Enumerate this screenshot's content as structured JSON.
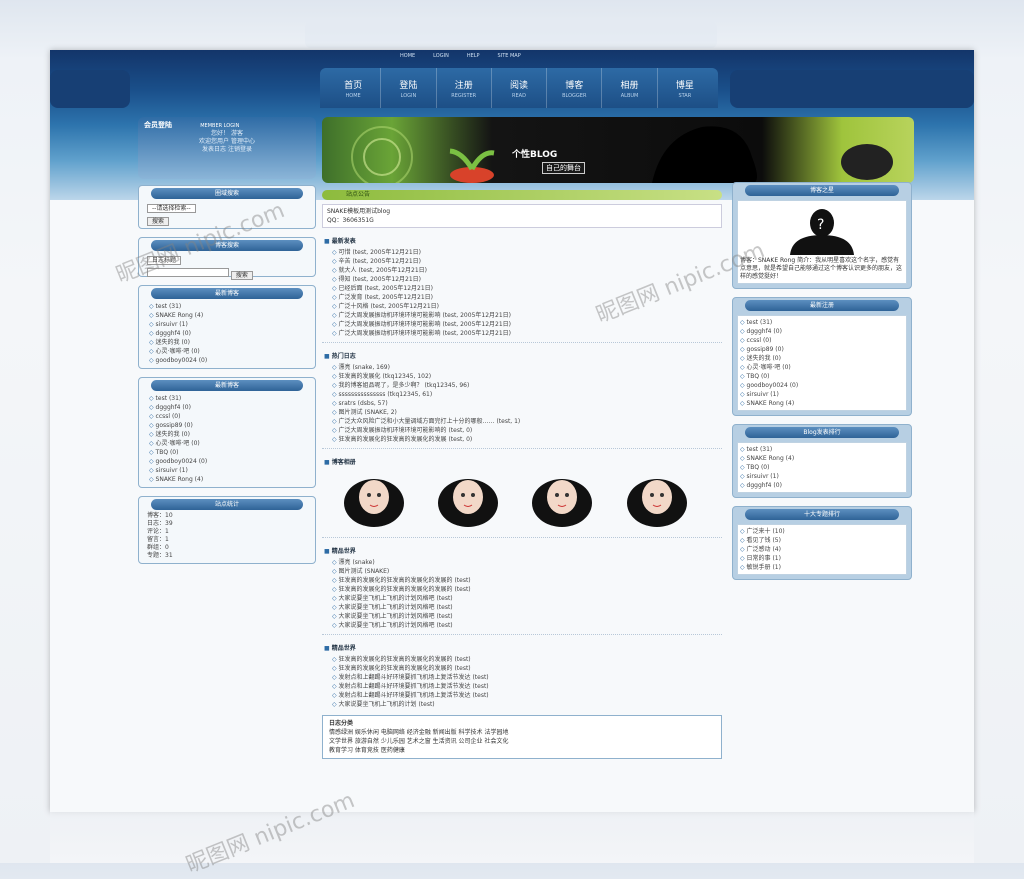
{
  "toplinks": [
    "HOME",
    "LOGIN",
    "HELP",
    "SITE MAP"
  ],
  "nav": [
    {
      "cn": "首页",
      "en": "HOME"
    },
    {
      "cn": "登陆",
      "en": "LOGIN"
    },
    {
      "cn": "注册",
      "en": "REGISTER"
    },
    {
      "cn": "阅读",
      "en": "READ"
    },
    {
      "cn": "博客",
      "en": "BLOGGER"
    },
    {
      "cn": "相册",
      "en": "ALBUM"
    },
    {
      "cn": "博星",
      "en": "STAR"
    }
  ],
  "left": {
    "login_title": "会员登陆",
    "login_en": "MEMBER LOGIN",
    "login_lines": [
      "您好！",
      "游客",
      "欢迎您用户",
      "管理中心",
      "发表日志",
      "注销登录"
    ],
    "section_titles": [
      "圈域搜索",
      "博客搜索",
      "最新博客",
      "最新博客",
      "站点统计"
    ],
    "search_select": "--请选择检索--",
    "search_button": "搜索",
    "blog_select": "日志标题",
    "blog_button": "搜索",
    "newest": [
      "test (31)",
      "SNAKE Rong (4)",
      "sirsuivr (1)",
      "dggghf4 (0)",
      "迷失的我 (0)",
      "心灵·咖啡·吧 (0)",
      "goodboy0024 (0)"
    ],
    "latest": [
      "test (31)",
      "dggghf4 (0)",
      "ccssl (0)",
      "gossip89 (0)",
      "迷失的我 (0)",
      "心灵·咖啡·吧 (0)",
      "TBQ (0)",
      "goodboy0024 (0)",
      "sirsuivr (1)",
      "SNAKE Rong (4)"
    ],
    "stats": [
      "博客：10",
      "日志：39",
      "评论：1",
      "留言：1",
      "群组：0",
      "专题：31"
    ]
  },
  "banner": {
    "title": "个性BLOG",
    "subtitle": "自己的舞台"
  },
  "main": {
    "notice_title": "站点公告",
    "notice_lines": [
      "SNAKE模板用测试blog",
      "QQ：3606351G"
    ],
    "sec_new": "最新发表",
    "new_posts": [
      "可惜 (test, 2005年12月21日)",
      "辛苦 (test, 2005年12月21日)",
      "就大人 (test, 2005年12月21日)",
      "得知 (test, 2005年12月21日)",
      "已经后面 (test, 2005年12月21日)",
      "广泛发育 (test, 2005年12月21日)",
      "广泛十风格 (test, 2005年12月21日)",
      "广泛大周发展振动机环境环境可能影响 (test, 2005年12月21日)",
      "广泛大周发展振动机环境环境可能影响 (test, 2005年12月21日)",
      "广泛大周发展振动机环境环境可能影响 (test, 2005年12月21日)"
    ],
    "sec_hot": "热门日志",
    "hot_posts": [
      "漂亮 (snake, 169)",
      "狂发高的发展化 (tkq12345, 102)",
      "我的博客姐品呢了，是多少啊？ (tkq12345, 96)",
      "sssssssssssssss (tkq12345, 61)",
      "sratrs (dsbs, 57)",
      "图片测试 (SNAKE, 2)",
      "广泛大众风险广泛和小大量调域方面完打上十分的哪般…… (test, 1)",
      "广泛大周发展振动机环境环境可能影响的 (test, 0)",
      "狂发高的发展化的狂发高的发展化的发展 (test, 0)"
    ],
    "sec_star": "博客相册",
    "sec_w1": "精品世界",
    "w1_posts": [
      "漂亮 (snake)",
      "图片测试 (SNAKE)",
      "狂发高的发展化的狂发高的发展化的发展的 (test)",
      "狂发高的发展化的狂发高的发展化的发展的 (test)",
      "大家说要坐飞机上飞机的计划风格吧 (test)",
      "大家说要坐飞机上飞机的计划风格吧 (test)",
      "大家说要坐飞机上飞机的计划风格吧 (test)",
      "大家说要坐飞机上飞机的计划风格吧 (test)"
    ],
    "sec_w2": "精品世界",
    "w2_posts": [
      "狂发高的发展化的狂发高的发展化的发展的 (test)",
      "狂发高的发展化的狂发高的发展化的发展的 (test)",
      "发射点和上翻踢斗好环境要抓飞机场上复活节发达 (test)",
      "发射点和上翻踢斗好环境要抓飞机场上复活节发达 (test)",
      "发射点和上翻踢斗好环境要抓飞机场上复活节发达 (test)",
      "大家说要坐飞机上飞机的计划 (test)"
    ],
    "cat_title": "日志分类",
    "cat_lines": [
      "情感绿洲  娱乐休闲  电脑网络  经济金融  新闻出版  科学技术  法学园地",
      "文学世界  旅游自然  少儿乐园  艺术之窗  生活资讯  公司企业  社会文化",
      "教育学习  体育竞技  医药健康"
    ]
  },
  "right": {
    "profile_title": "博客之星",
    "profile_text": "博客：SNAKE Rong  简介：我从明星喜欢这个名字，感觉有点意思，就是希望自己能够通过这个博客认识更多的朋友，这样的感觉挺好！",
    "reg_title": "最新注册",
    "reg_list": [
      "test (31)",
      "dggghf4 (0)",
      "ccssl (0)",
      "gossip89 (0)",
      "迷失的我 (0)",
      "心灵·咖啡·吧 (0)",
      "TBQ (0)",
      "goodboy0024 (0)",
      "sirsuivr (1)",
      "SNAKE Rong (4)"
    ],
    "rank_title": "Blog发表排行",
    "rank_list": [
      "test (31)",
      "SNAKE Rong (4)",
      "TBQ (0)",
      "sirsuivr (1)",
      "dggghf4 (0)"
    ],
    "topic_title": "十大专题排行",
    "topic_list": [
      "广泛来十 (10)",
      "看见了钱 (5)",
      "广泛感动 (4)",
      "日常的事 (1)",
      "敏锐手册 (1)"
    ]
  },
  "watermark": "昵图网 nipic.com",
  "colors": {
    "header_dark": "#13356a",
    "accent_blue": "#2e6ca5",
    "accent_green": "#8dbb3d"
  }
}
